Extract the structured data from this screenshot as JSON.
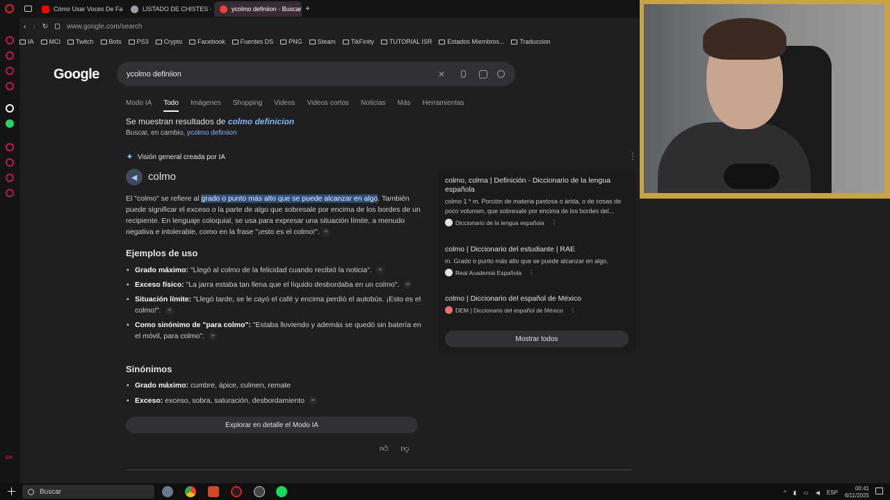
{
  "browser": {
    "tabs": [
      {
        "label": "Cómo Usar Voces De Fam",
        "color": "#ff0000"
      },
      {
        "label": "LISTADO DE CHISTES - E",
        "color": "#9aa0a6"
      },
      {
        "label": "ycolmo definiion - Buscar",
        "color": "#ea4335"
      }
    ],
    "new_tab": "+",
    "url": "www.google.com/search",
    "bookmarks": [
      "IA",
      "MCI",
      "Twitch",
      "Bots",
      "PS3",
      "Crypto",
      "Facebook",
      "Fuentes DS",
      "PNG",
      "Steam",
      "TikFinity",
      "TUTORIAL ISR",
      "Estados Miembros...",
      "Traduccion"
    ]
  },
  "google": {
    "logo": "Google",
    "query": "ycolmo definiion",
    "tabs": [
      "Modo IA",
      "Todo",
      "Imágenes",
      "Shopping",
      "Videos",
      "Videos cortos",
      "Noticias",
      "Más",
      "Herramientas"
    ],
    "active_tab": "Todo",
    "correction_prefix": "Se muestran resultados de",
    "correction_term": "colmo definicion",
    "instead_prefix": "Buscar, en cambio,",
    "instead_term": "ycolmo definiion"
  },
  "ai": {
    "header": "Visión general creada por IA",
    "word": "colmo",
    "def_pre": "El \"colmo\" se refiere al",
    "def_hl": "grado o punto más alto que se puede alcanzar en algo",
    "def_post": ". También puede significar el exceso o la parte de algo que sobresale por encima de los bordes de un recipiente. En lenguaje coloquial, se usa para expresar una situación límite, a menudo negativa e intolerable, como en la frase \"¡esto es el colmo!\".",
    "examples_title": "Ejemplos de uso",
    "examples": [
      {
        "term": "Grado máximo:",
        "text": "\"Llegó al colmo de la felicidad cuando recibió la noticia\"."
      },
      {
        "term": "Exceso físico:",
        "text": "\"La jarra estaba tan llena que el líquido desbordaba en un colmo\"."
      },
      {
        "term": "Situación límite:",
        "text": "\"Llegó tarde, se le cayó el café y encima perdió el autobús. ¡Esto es el colmo!\"."
      },
      {
        "term": "Como sinónimo de \"para colmo\":",
        "text": "\"Estaba lloviendo y además se quedó sin batería en el móvil, para colmo\"."
      }
    ],
    "synonyms_title": "Sinónimos",
    "synonyms": [
      {
        "term": "Grado máximo:",
        "text": "cumbre, ápice, culmen, remate"
      },
      {
        "term": "Exceso:",
        "text": "exceso, sobra, saturación, desbordamiento"
      }
    ],
    "explore": "Explorar en detalle el Modo IA"
  },
  "sources": [
    {
      "title": "colmo, colma | Definición - Diccionario de la lengua española",
      "desc": "colmo 1 * m. Porción de materia pastosa o árida, o de cosas de poco volumen, que sobresale por encima de los bordes del...",
      "origin": "Diccionario de la lengua española"
    },
    {
      "title": "colmo | Diccionario del estudiante | RAE",
      "desc": "m. Grado o punto más alto que se puede alcanzar en algo.",
      "origin": "Real Academia Española"
    },
    {
      "title": "colmo | Diccionario del español de México",
      "desc": "",
      "origin": "DEM | Diccionario del español de México"
    }
  ],
  "show_all": "Mostrar todos",
  "taskbar": {
    "search": "Buscar",
    "lang": "ESP",
    "time": "00:41",
    "date": "6/11/2025"
  }
}
